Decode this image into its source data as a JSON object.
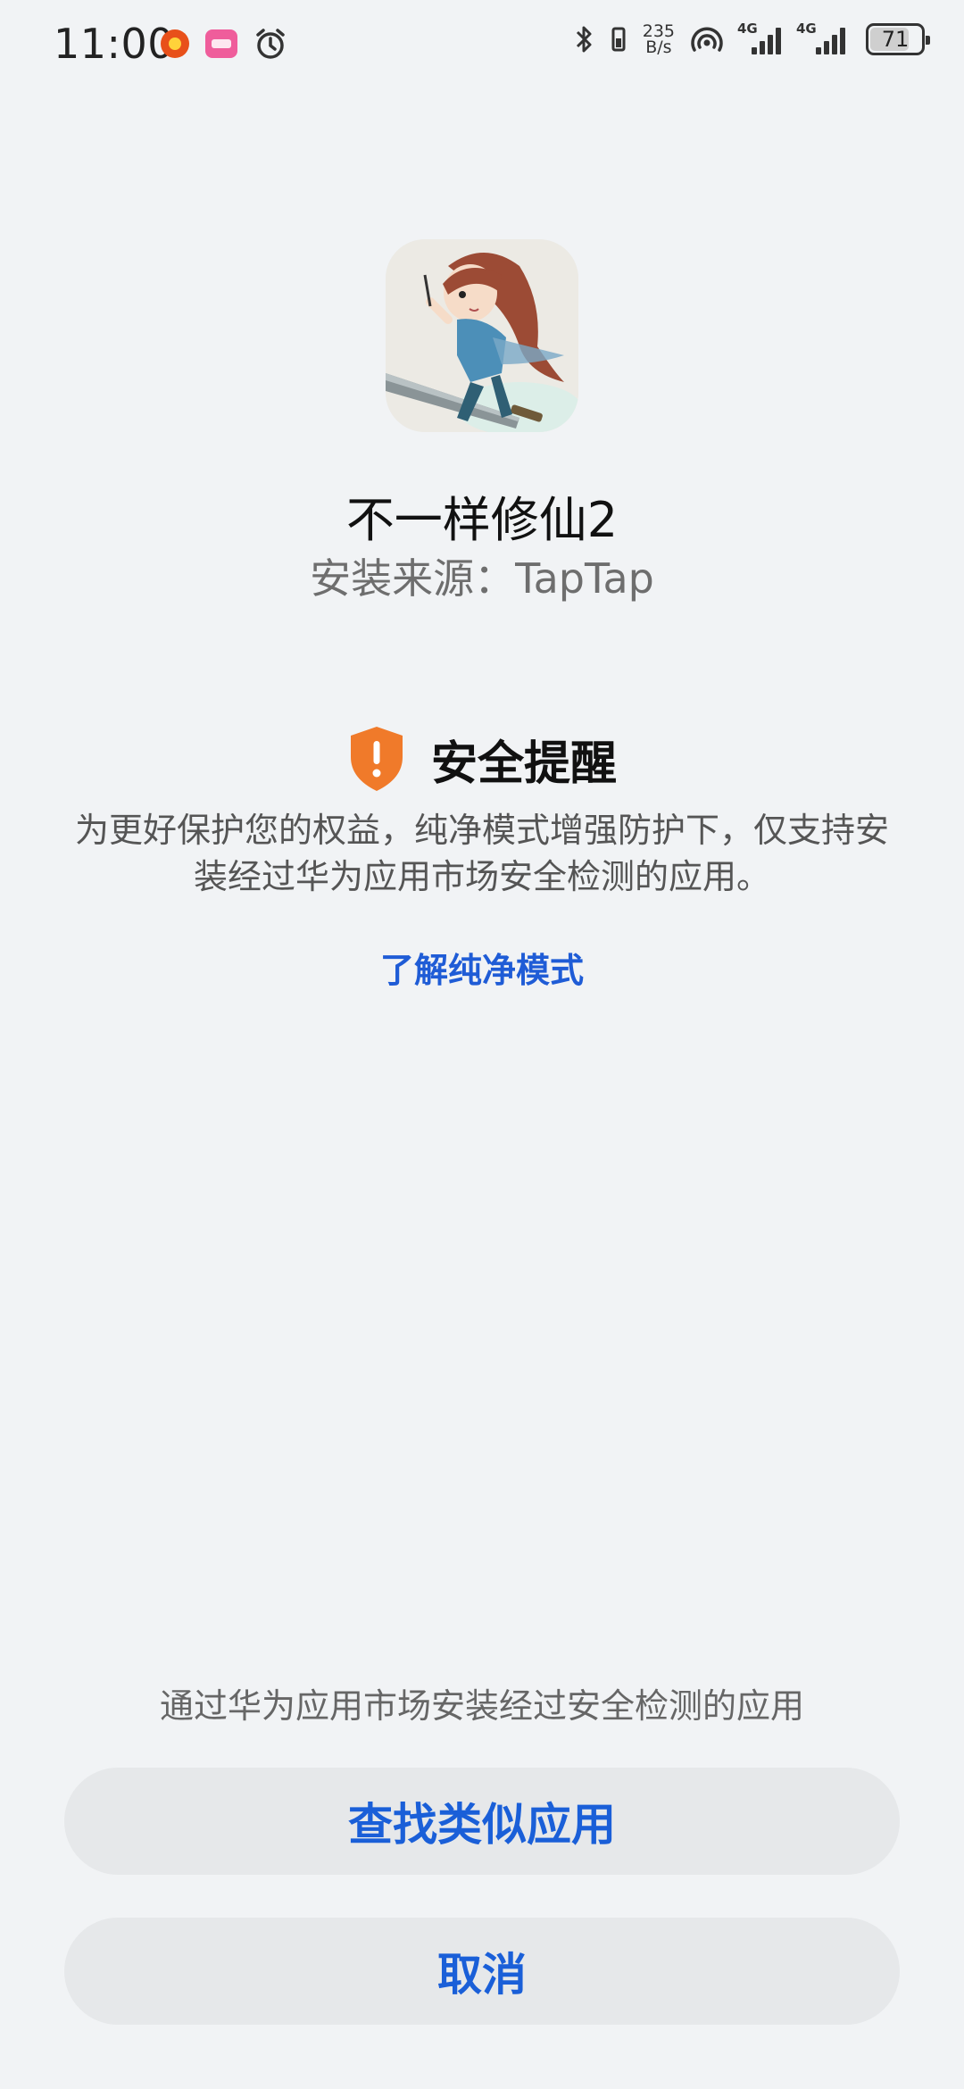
{
  "status_bar": {
    "time": "11:00",
    "net_speed_value": "235",
    "net_speed_unit": "B/s",
    "sim1_network": "4G",
    "sim2_network": "4G",
    "battery_level": "71",
    "icons": [
      "app-notification-icon",
      "app-notification-icon",
      "alarm-icon",
      "bluetooth-icon",
      "vibrate-icon",
      "hotspot-icon",
      "signal-icon",
      "signal-icon",
      "battery-icon"
    ]
  },
  "app": {
    "name": "不一样修仙2",
    "install_source": "安装来源：TapTap"
  },
  "security_notice": {
    "title": "安全提醒",
    "body": "为更好保护您的权益，纯净模式增强防护下，仅支持安装经过华为应用市场安全检测的应用。",
    "learn_more_link": "了解纯净模式",
    "icon": "shield-warning-icon",
    "icon_color": "#f07a2a"
  },
  "bottom": {
    "hint": "通过华为应用市场安装经过安全检测的应用",
    "find_similar_button": "查找类似应用",
    "cancel_button": "取消"
  },
  "colors": {
    "background": "#f1f3f5",
    "accent": "#1a5fd8",
    "button_bg": "#e6e8ea"
  }
}
